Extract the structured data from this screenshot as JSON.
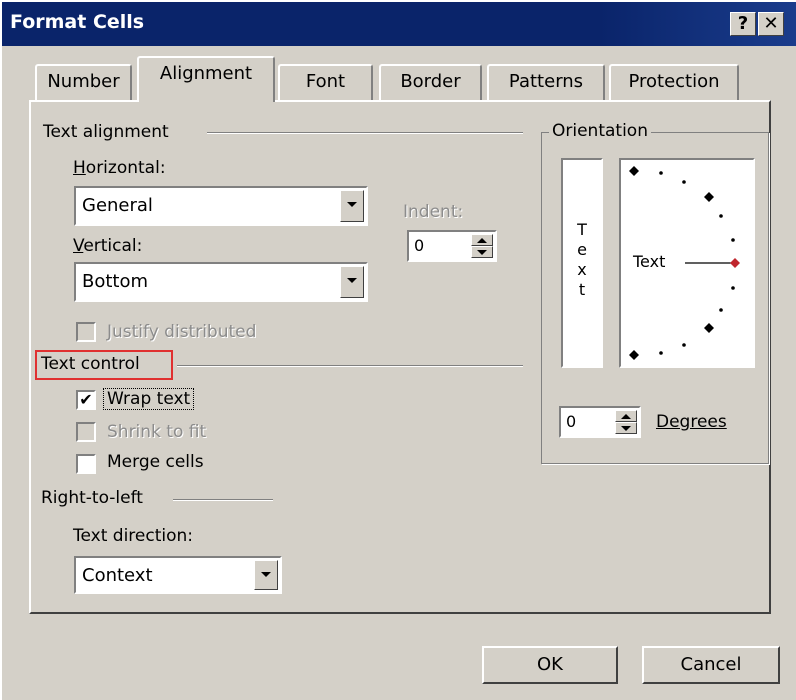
{
  "window": {
    "title": "Format Cells",
    "help_label": "?",
    "close_label": "✕"
  },
  "tabs": [
    {
      "label": "Number"
    },
    {
      "label": "Alignment"
    },
    {
      "label": "Font"
    },
    {
      "label": "Border"
    },
    {
      "label": "Patterns"
    },
    {
      "label": "Protection"
    }
  ],
  "alignment": {
    "text_alignment_label": "Text alignment",
    "horizontal_label": "Horizontal:",
    "horizontal_value": "General",
    "indent_label": "Indent:",
    "indent_value": "0",
    "vertical_label": "Vertical:",
    "vertical_value": "Bottom",
    "justify_label": "Justify distributed"
  },
  "text_control": {
    "label": "Text control",
    "highlight_color": "#e03030",
    "wrap_label": "Wrap text",
    "wrap_checked": true,
    "shrink_label": "Shrink to fit",
    "merge_label": "Merge cells"
  },
  "rtl": {
    "label": "Right-to-left",
    "direction_label": "Text direction:",
    "direction_value": "Context"
  },
  "orientation": {
    "label": "Orientation",
    "vertical_text": [
      "T",
      "e",
      "x",
      "t"
    ],
    "dial_text": "Text",
    "degrees_value": "0",
    "degrees_label": "Degrees",
    "marker_color": "#c0262d"
  },
  "buttons": {
    "ok": "OK",
    "cancel": "Cancel"
  }
}
